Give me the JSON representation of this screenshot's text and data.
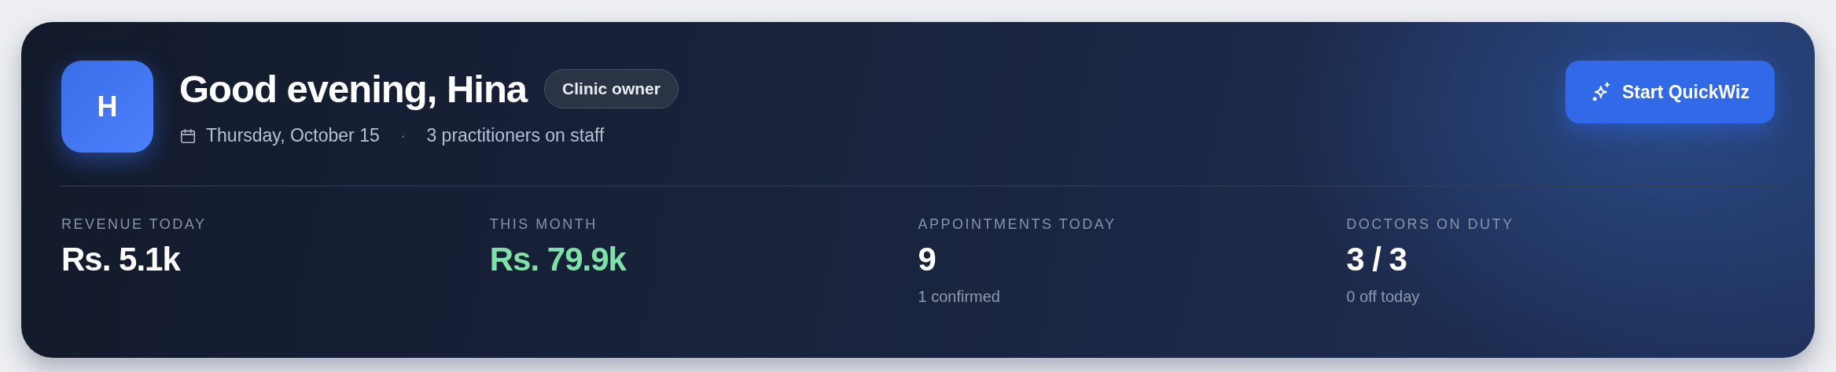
{
  "header": {
    "avatar": "H",
    "greeting": "Good evening, Hina",
    "role_badge": "Clinic owner",
    "date": "Thursday, October 15",
    "separator": "·",
    "staff": "3 practitioners on staff"
  },
  "action_button": {
    "label": "Start QuickWiz"
  },
  "stats": [
    {
      "label": "REVENUE TODAY",
      "value": "Rs. 5.1k",
      "kind": "default"
    },
    {
      "label": "THIS MONTH",
      "value": "Rs. 79.9k",
      "kind": "positive"
    },
    {
      "label": "APPOINTMENTS TODAY",
      "value": "9",
      "kind": "default",
      "sub": "1 confirmed"
    },
    {
      "label": "DOCTORS ON DUTY",
      "value": "3 / 3",
      "kind": "default",
      "sub": "0 off today"
    }
  ]
}
